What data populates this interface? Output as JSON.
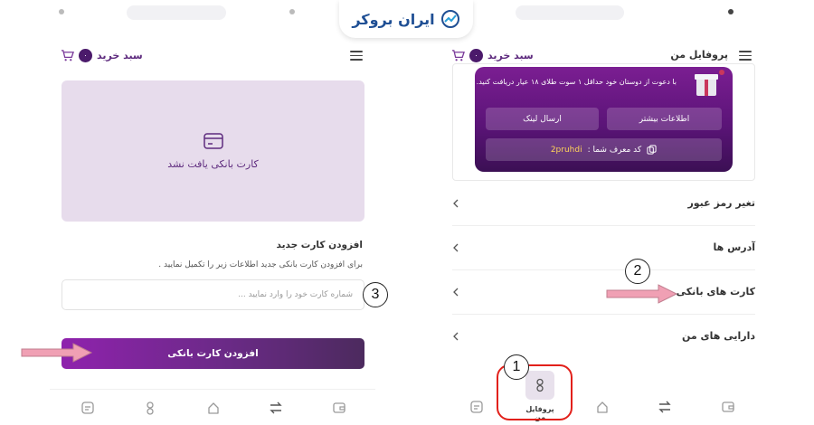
{
  "logo": {
    "text": "ایران بروکر",
    "icon": "chart-trend-logo-icon"
  },
  "left": {
    "cart": {
      "label": "سبد خرید",
      "count": "۰"
    },
    "empty_state": {
      "text": "کارت بانکی یافت نشد",
      "icon": "credit-card-icon"
    },
    "add_section": {
      "title": "افزودن کارت جدید",
      "subtitle": "برای افزودن کارت بانکی جدید اطلاعات زیر را تکمیل نمایید .",
      "placeholder": "شماره کارت خود را وارد نمایید ...",
      "button_label": "افزودن کارت بانکی"
    },
    "nav_icons": [
      "wallet-icon",
      "swap-icon",
      "home-icon",
      "profile-icon",
      "orders-icon"
    ]
  },
  "right": {
    "page_title": "پروفایل من",
    "cart": {
      "label": "سبد خرید",
      "count": "۰"
    },
    "invite": {
      "text": "با دعوت از دوستان خود حداقل ۱ سوت طلای ۱۸ عیار دریافت کنید.",
      "more_info": "اطلاعات بیشتر",
      "send_link": "ارسال لینک",
      "referral_label": "کد معرف شما :",
      "referral_code": "2pruhdi"
    },
    "menu": [
      {
        "label": "تغیر رمز عبور"
      },
      {
        "label": "آدرس ها"
      },
      {
        "label": "کارت های بانکی"
      },
      {
        "label": "دارایی های من"
      }
    ],
    "nav": {
      "active_label": "پروفایل من"
    },
    "nav_icons": [
      "wallet-icon",
      "swap-icon",
      "home-icon",
      "profile-icon",
      "orders-icon"
    ]
  },
  "annotations": {
    "step1": "1",
    "step2": "2",
    "step3": "3"
  },
  "colors": {
    "brand_purple": "#5e2b7e",
    "highlight_red": "#e2201a",
    "arrow_pink": "#f0a0b4",
    "logo_blue": "#1f4f94"
  }
}
